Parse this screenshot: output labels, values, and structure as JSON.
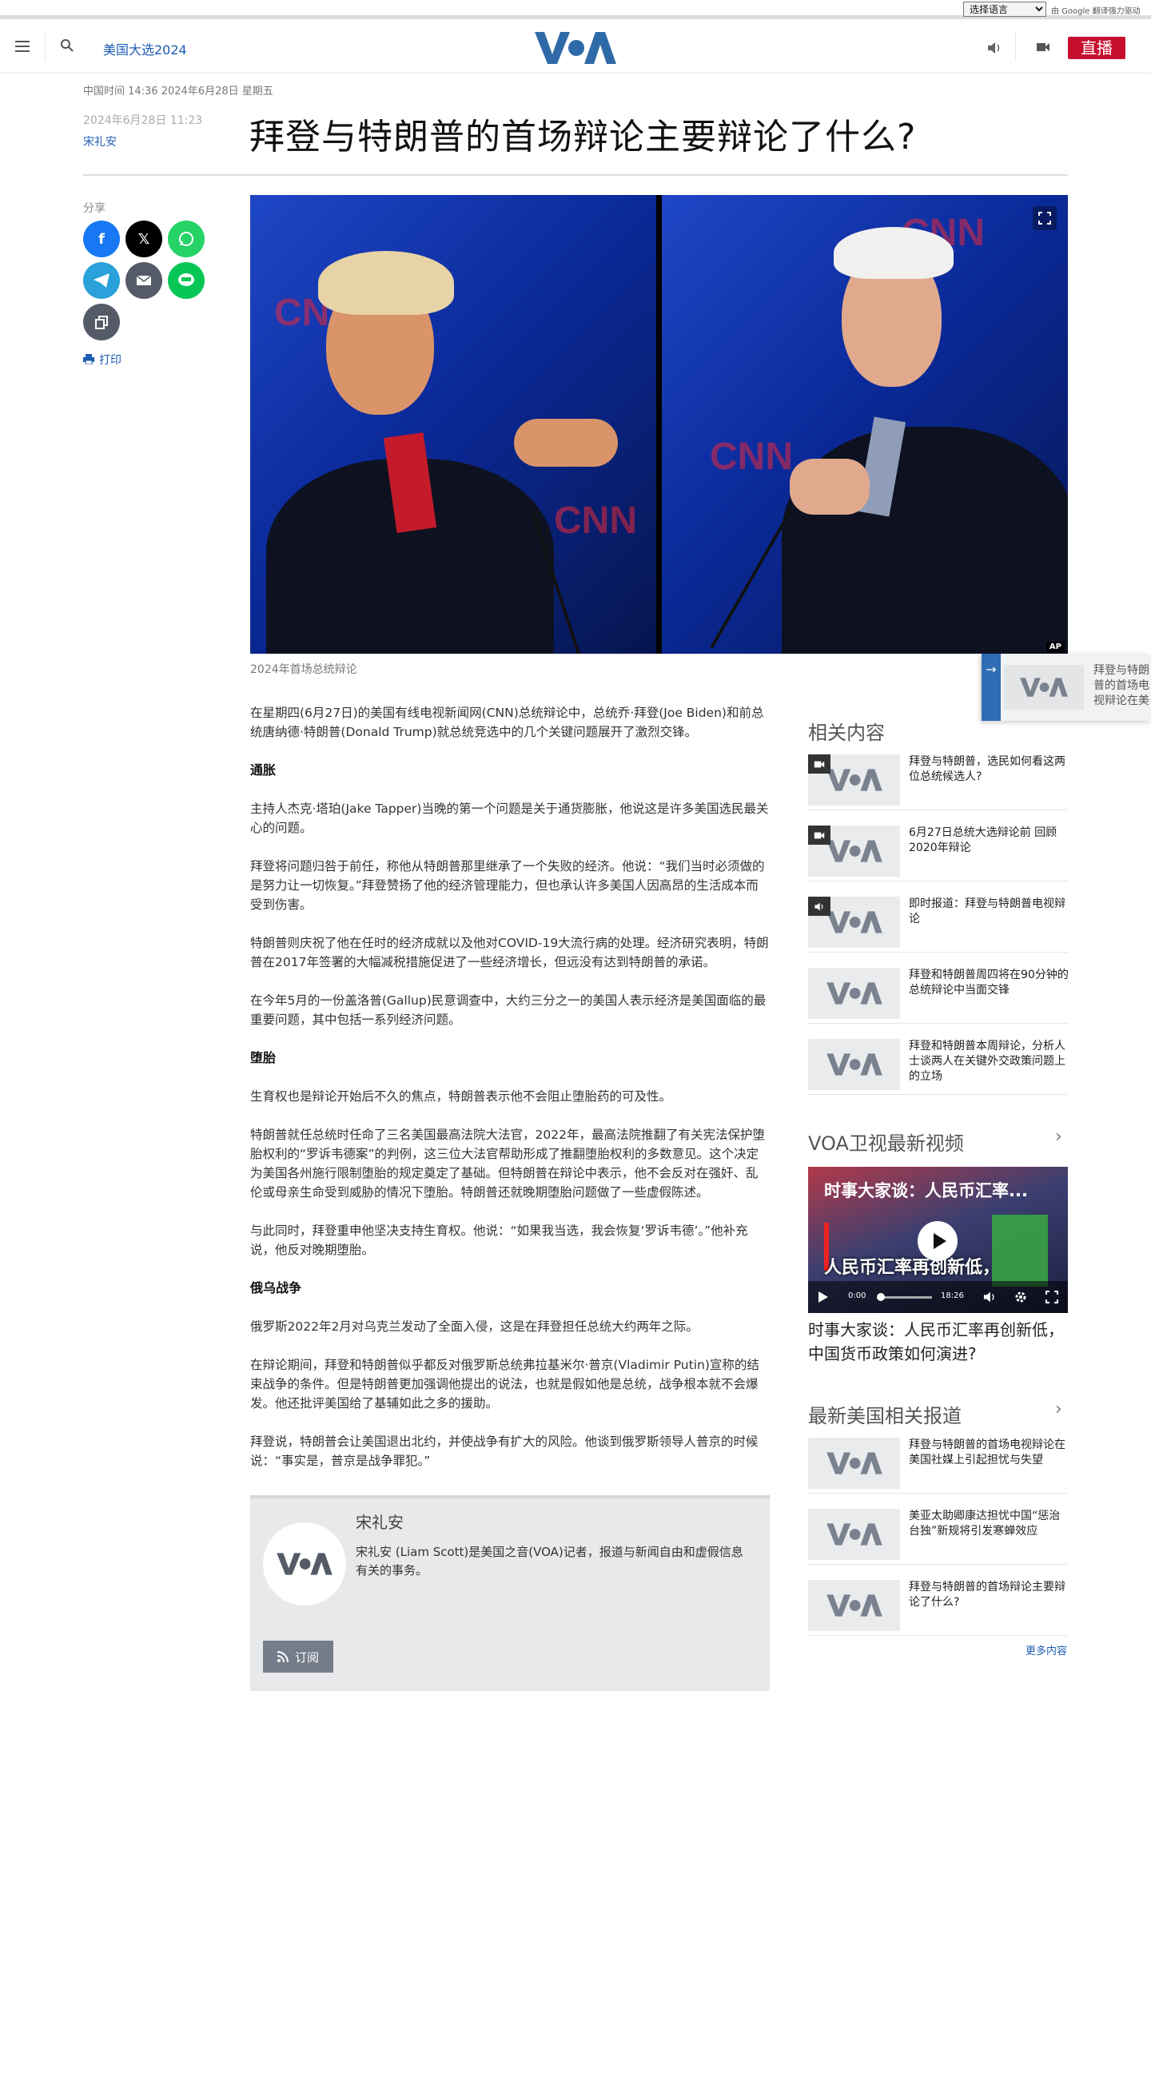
{
  "top_bar": {
    "language_select": "选择语言",
    "powered_by": "由 Google 翻译强力驱动"
  },
  "header": {
    "nav_link": "美国大选2024",
    "live_label": "直播",
    "logo_alt": "VOA"
  },
  "article": {
    "dateline": "中国时间 14:36 2024年6月28日 星期五",
    "published": "2024年6月28日 11:23",
    "author": "宋礼安",
    "headline": "拜登与特朗普的首场辩论主要辩论了什么?",
    "share_label": "分享",
    "print_label": "打印",
    "image_caption": "2024年首场总统辩论",
    "image_credit": "AP",
    "body": [
      {
        "type": "p",
        "text": "在星期四(6月27日)的美国有线电视新闻网(CNN)总统辩论中，总统乔·拜登(Joe Biden)和前总统唐纳德·特朗普(Donald Trump)就总统竞选中的几个关键问题展开了激烈交锋。"
      },
      {
        "type": "h",
        "text": "通胀"
      },
      {
        "type": "p",
        "text": "主持人杰克·塔珀(Jake Tapper)当晚的第一个问题是关于通货膨胀，他说这是许多美国选民最关心的问题。"
      },
      {
        "type": "p",
        "text": "拜登将问题归咎于前任，称他从特朗普那里继承了一个失败的经济。他说：“我们当时必须做的是努力让一切恢复。”拜登赞扬了他的经济管理能力，但也承认许多美国人因高昂的生活成本而受到伤害。"
      },
      {
        "type": "p",
        "text": "特朗普则庆祝了他在任时的经济成就以及他对COVID-19大流行病的处理。经济研究表明，特朗普在2017年签署的大幅减税措施促进了一些经济增长，但远没有达到特朗普的承诺。"
      },
      {
        "type": "p",
        "text": "在今年5月的一份盖洛普(Gallup)民意调查中，大约三分之一的美国人表示经济是美国面临的最重要问题，其中包括一系列经济问题。"
      },
      {
        "type": "h",
        "text": "堕胎"
      },
      {
        "type": "p",
        "text": "生育权也是辩论开始后不久的焦点，特朗普表示他不会阻止堕胎药的可及性。"
      },
      {
        "type": "p",
        "text": "特朗普就任总统时任命了三名美国最高法院大法官，2022年，最高法院推翻了有关宪法保护堕胎权利的“罗诉韦德案”的判例，这三位大法官帮助形成了推翻堕胎权利的多数意见。这个决定为美国各州施行限制堕胎的规定奠定了基础。但特朗普在辩论中表示，他不会反对在强奸、乱伦或母亲生命受到威胁的情况下堕胎。特朗普还就晚期堕胎问题做了一些虚假陈述。"
      },
      {
        "type": "p",
        "text": "与此同时，拜登重申他坚决支持生育权。他说：“如果我当选，我会恢复‘罗诉韦德’。”他补充说，他反对晚期堕胎。"
      },
      {
        "type": "h",
        "text": "俄乌战争"
      },
      {
        "type": "p",
        "text": "俄罗斯2022年2月对乌克兰发动了全面入侵，这是在拜登担任总统大约两年之际。"
      },
      {
        "type": "p",
        "text": "在辩论期间，拜登和特朗普似乎都反对俄罗斯总统弗拉基米尔·普京(Vladimir Putin)宣称的结束战争的条件。但是特朗普更加强调他提出的说法，也就是假如他是总统，战争根本就不会爆发。他还批评美国给了基辅如此之多的援助。"
      },
      {
        "type": "p",
        "text": "拜登说，特朗普会让美国退出北约，并使战争有扩大的风险。他谈到俄罗斯领导人普京的时候说：“事实是，普京是战争罪犯。”"
      }
    ]
  },
  "author_box": {
    "name": "宋礼安",
    "bio": "宋礼安 (Liam Scott)是美国之音(VOA)记者，报道与新闻自由和虚假信息有关的事务。",
    "subscribe_label": "订阅"
  },
  "sidebar": {
    "related_title": "相关内容",
    "related": [
      {
        "text": "拜登与特朗普，选民如何看这两位总统候选人?",
        "badge": "video-icon"
      },
      {
        "text": "6月27日总统大选辩论前 回顾2020年辩论",
        "badge": "video-icon"
      },
      {
        "text": "即时报道：拜登与特朗普电视辩论",
        "badge": "audio-icon"
      },
      {
        "text": "拜登和特朗普周四将在90分钟的总统辩论中当面交锋",
        "badge": ""
      },
      {
        "text": "拜登和特朗普本周辩论，分析人士谈两人在关键外交政策问题上的立场",
        "badge": ""
      }
    ],
    "video_section_title": "VOA卫视最新视频",
    "video": {
      "overlay_title": "时事大家谈：人民币汇率...",
      "overlay_text": "人民币汇率再创新低，",
      "time_current": "0:00",
      "time_total": "18:26",
      "caption": "时事大家谈：人民币汇率再创新低，中国货币政策如何演进?"
    },
    "latest_title": "最新美国相关报道",
    "latest": [
      {
        "text": "拜登与特朗普的首场电视辩论在美国社媒上引起担忧与失望"
      },
      {
        "text": "美亚太助卿康达担忧中国“惩治台独”新规将引发寒蝉效应"
      },
      {
        "text": "拜登与特朗普的首场辩论主要辩论了什么?"
      }
    ],
    "more_label": "更多内容"
  },
  "floating_card": {
    "text": "拜登与特朗普的首场电视辩论在美国社媒上引起担忧与失望"
  },
  "colors": {
    "brand_blue": "#1e5db3",
    "live_red": "#c8102e",
    "voa_logo": "#2f6aa8"
  }
}
